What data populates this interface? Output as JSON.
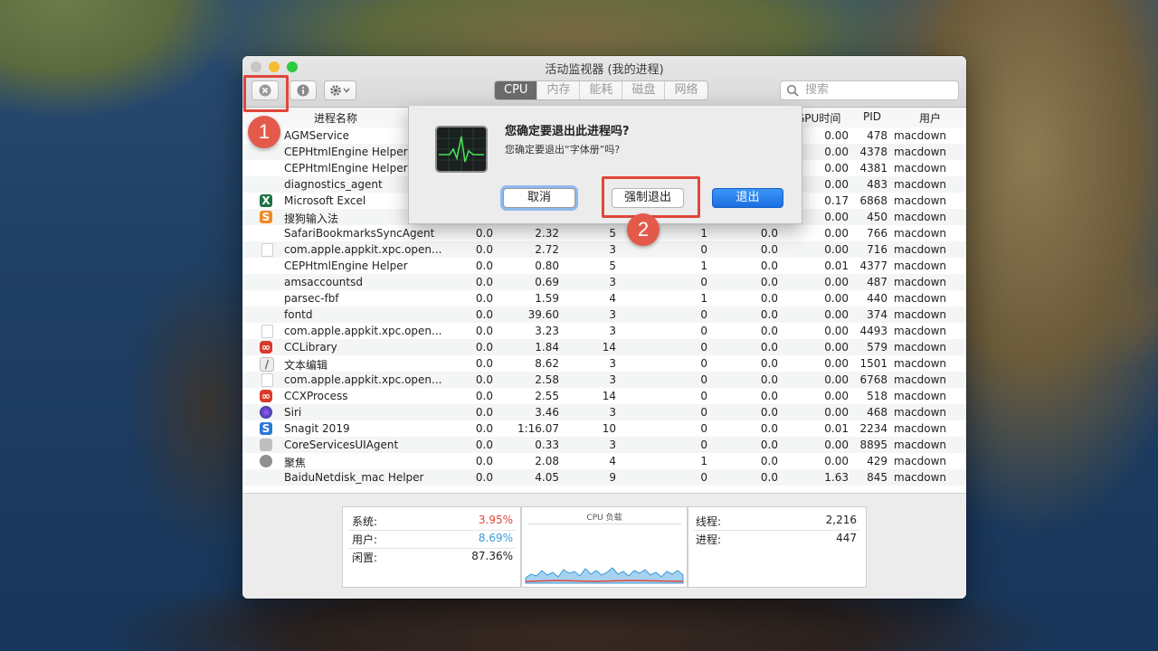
{
  "window": {
    "title": "活动监视器 (我的进程)",
    "tabs": [
      "CPU",
      "内存",
      "能耗",
      "磁盘",
      "网络"
    ],
    "active_tab": "CPU",
    "search_placeholder": "搜索"
  },
  "table": {
    "headers": {
      "name": "进程名称",
      "gpu_time": "GPU时间",
      "pid": "PID",
      "user": "用户"
    },
    "rows": [
      {
        "icon": "",
        "name": "AGMService",
        "cpu": "",
        "time": "",
        "threads": "",
        "wake": "",
        "pct": "",
        "gpu": "0.00",
        "pid": "478",
        "user": "macdown"
      },
      {
        "icon": "",
        "name": "CEPHtmlEngine Helper",
        "cpu": "",
        "time": "",
        "threads": "",
        "wake": "",
        "pct": "",
        "gpu": "0.00",
        "pid": "4378",
        "user": "macdown"
      },
      {
        "icon": "",
        "name": "CEPHtmlEngine Helper",
        "cpu": "",
        "time": "",
        "threads": "",
        "wake": "",
        "pct": "",
        "gpu": "0.00",
        "pid": "4381",
        "user": "macdown"
      },
      {
        "icon": "",
        "name": "diagnostics_agent",
        "cpu": "",
        "time": "",
        "threads": "",
        "wake": "",
        "pct": "",
        "gpu": "0.00",
        "pid": "483",
        "user": "macdown"
      },
      {
        "icon": "excel-icon",
        "name": "Microsoft Excel",
        "cpu": "",
        "time": "",
        "threads": "",
        "wake": "",
        "pct": "",
        "gpu": "0.17",
        "pid": "6868",
        "user": "macdown"
      },
      {
        "icon": "sogou-icon",
        "name": "搜狗输入法",
        "cpu": "",
        "time": "",
        "threads": "",
        "wake": "",
        "pct": "",
        "gpu": "0.00",
        "pid": "450",
        "user": "macdown"
      },
      {
        "icon": "",
        "name": "SafariBookmarksSyncAgent",
        "cpu": "0.0",
        "time": "2.32",
        "threads": "5",
        "wake": "1",
        "pct": "0.0",
        "gpu": "0.00",
        "pid": "766",
        "user": "macdown"
      },
      {
        "icon": "document-icon",
        "name": "com.apple.appkit.xpc.open...",
        "cpu": "0.0",
        "time": "2.72",
        "threads": "3",
        "wake": "0",
        "pct": "0.0",
        "gpu": "0.00",
        "pid": "716",
        "user": "macdown"
      },
      {
        "icon": "",
        "name": "CEPHtmlEngine Helper",
        "cpu": "0.0",
        "time": "0.80",
        "threads": "5",
        "wake": "1",
        "pct": "0.0",
        "gpu": "0.01",
        "pid": "4377",
        "user": "macdown"
      },
      {
        "icon": "",
        "name": "amsaccountsd",
        "cpu": "0.0",
        "time": "0.69",
        "threads": "3",
        "wake": "0",
        "pct": "0.0",
        "gpu": "0.00",
        "pid": "487",
        "user": "macdown"
      },
      {
        "icon": "",
        "name": "parsec-fbf",
        "cpu": "0.0",
        "time": "1.59",
        "threads": "4",
        "wake": "1",
        "pct": "0.0",
        "gpu": "0.00",
        "pid": "440",
        "user": "macdown"
      },
      {
        "icon": "",
        "name": "fontd",
        "cpu": "0.0",
        "time": "39.60",
        "threads": "3",
        "wake": "0",
        "pct": "0.0",
        "gpu": "0.00",
        "pid": "374",
        "user": "macdown"
      },
      {
        "icon": "document-icon",
        "name": "com.apple.appkit.xpc.open...",
        "cpu": "0.0",
        "time": "3.23",
        "threads": "3",
        "wake": "0",
        "pct": "0.0",
        "gpu": "0.00",
        "pid": "4493",
        "user": "macdown"
      },
      {
        "icon": "cc-icon",
        "name": "CCLibrary",
        "cpu": "0.0",
        "time": "1.84",
        "threads": "14",
        "wake": "0",
        "pct": "0.0",
        "gpu": "0.00",
        "pid": "579",
        "user": "macdown"
      },
      {
        "icon": "textedit-icon",
        "name": "文本编辑",
        "cpu": "0.0",
        "time": "8.62",
        "threads": "3",
        "wake": "0",
        "pct": "0.0",
        "gpu": "0.00",
        "pid": "1501",
        "user": "macdown"
      },
      {
        "icon": "document-icon",
        "name": "com.apple.appkit.xpc.open...",
        "cpu": "0.0",
        "time": "2.58",
        "threads": "3",
        "wake": "0",
        "pct": "0.0",
        "gpu": "0.00",
        "pid": "6768",
        "user": "macdown"
      },
      {
        "icon": "cc-icon",
        "name": "CCXProcess",
        "cpu": "0.0",
        "time": "2.55",
        "threads": "14",
        "wake": "0",
        "pct": "0.0",
        "gpu": "0.00",
        "pid": "518",
        "user": "macdown"
      },
      {
        "icon": "siri-icon",
        "name": "Siri",
        "cpu": "0.0",
        "time": "3.46",
        "threads": "3",
        "wake": "0",
        "pct": "0.0",
        "gpu": "0.00",
        "pid": "468",
        "user": "macdown"
      },
      {
        "icon": "snagit-icon",
        "name": "Snagit 2019",
        "cpu": "0.0",
        "time": "1:16.07",
        "threads": "10",
        "wake": "0",
        "pct": "0.0",
        "gpu": "0.01",
        "pid": "2234",
        "user": "macdown"
      },
      {
        "icon": "coreservices-icon",
        "name": "CoreServicesUIAgent",
        "cpu": "0.0",
        "time": "0.33",
        "threads": "3",
        "wake": "0",
        "pct": "0.0",
        "gpu": "0.00",
        "pid": "8895",
        "user": "macdown"
      },
      {
        "icon": "spotlight-icon",
        "name": "聚焦",
        "cpu": "0.0",
        "time": "2.08",
        "threads": "4",
        "wake": "1",
        "pct": "0.0",
        "gpu": "0.00",
        "pid": "429",
        "user": "macdown"
      },
      {
        "icon": "",
        "name": "BaiduNetdisk_mac Helper",
        "cpu": "0.0",
        "time": "4.05",
        "threads": "9",
        "wake": "0",
        "pct": "0.0",
        "gpu": "1.63",
        "pid": "845",
        "user": "macdown"
      }
    ]
  },
  "stats": {
    "system_label": "系统:",
    "system_value": "3.95%",
    "user_label": "用户:",
    "user_value": "8.69%",
    "idle_label": "闲置:",
    "idle_value": "87.36%",
    "cpu_load_title": "CPU 负载",
    "threads_label": "线程:",
    "threads_value": "2,216",
    "processes_label": "进程:",
    "processes_value": "447",
    "system_color": "#e0463b",
    "user_color": "#3a9ad9"
  },
  "dialog": {
    "title": "您确定要退出此进程吗?",
    "message": "您确定要退出“字体册”吗?",
    "cancel": "取消",
    "force_quit": "强制退出",
    "quit": "退出"
  },
  "annotations": {
    "step1": "1",
    "step2": "2",
    "color": "#e0463b"
  }
}
